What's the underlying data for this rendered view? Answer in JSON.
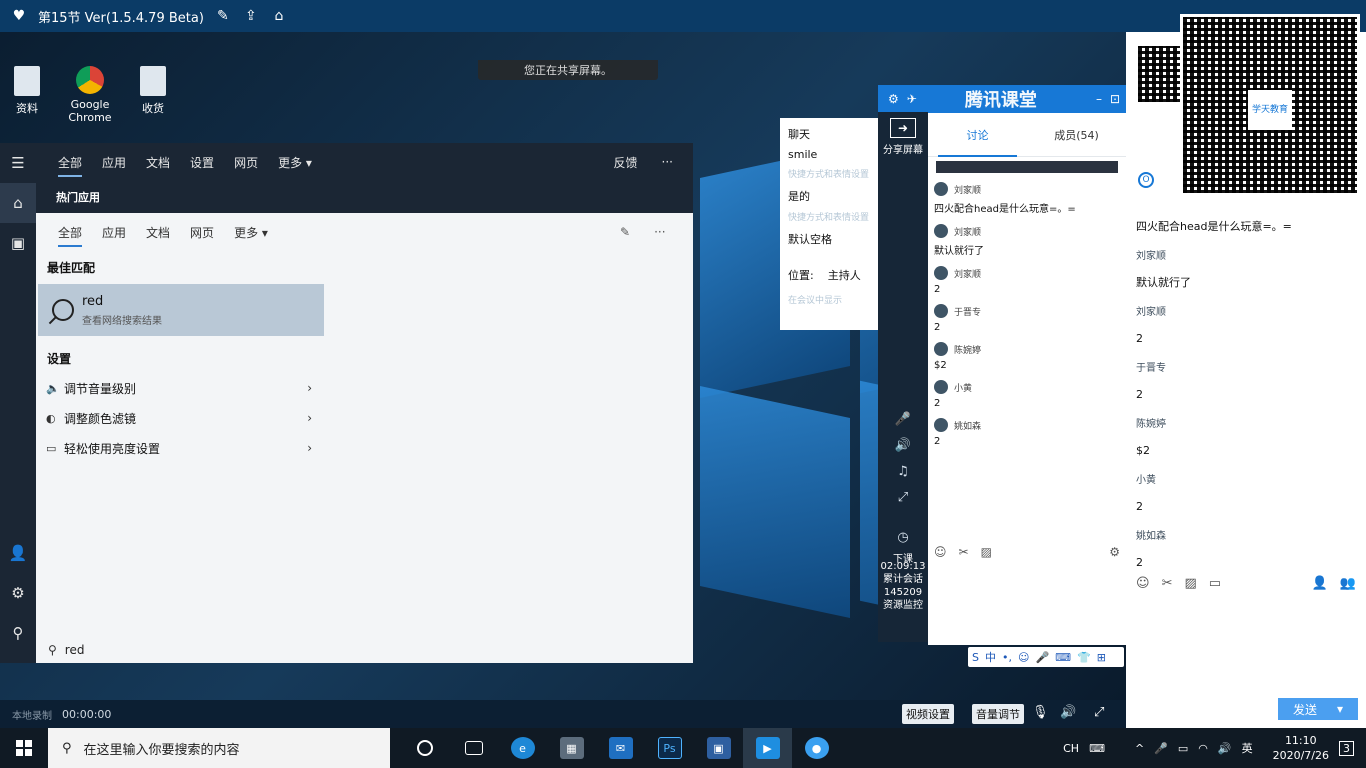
{
  "app_titlebar": {
    "title": "第15节 Ver(1.5.4.79 Beta)"
  },
  "desktop": {
    "share_banner": "您正在共享屏幕。",
    "icons": [
      {
        "label": "资料",
        "icon": "folder-icon"
      },
      {
        "label": "Google Chrome",
        "icon": "chrome-icon"
      },
      {
        "label": "收货",
        "icon": "folder-icon"
      }
    ]
  },
  "search_panel": {
    "tabs_dark": [
      "全部",
      "应用",
      "文档",
      "设置",
      "网页",
      "更多 ▾"
    ],
    "feedback_label": "反馈",
    "more_label": "···",
    "dark_hint": "热门应用",
    "tabs_light": [
      "全部",
      "应用",
      "文档",
      "网页",
      "更多 ▾"
    ],
    "best_match_heading": "最佳匹配",
    "best_match": {
      "title": "red",
      "subtitle": "查看网络搜索结果"
    },
    "settings_heading": "设置",
    "settings_items": [
      {
        "label": "调节音量级别",
        "icon": "speaker-icon"
      },
      {
        "label": "调整颜色滤镜",
        "icon": "palette-icon"
      },
      {
        "label": "轻松使用亮度设置",
        "icon": "monitor-icon"
      }
    ],
    "query": "red"
  },
  "popup": {
    "lines": [
      "聊天",
      "smile",
      "是的",
      "默认空格"
    ],
    "faint_line": "快捷方式和表情设置",
    "position_label": "位置:",
    "position_value": "主持人",
    "footer": "在会议中显示"
  },
  "meeting_toolbar": {
    "share_label": "分享屏幕",
    "timer": "02:09:13",
    "stats": [
      "累计会话",
      "145209",
      "资源监控"
    ],
    "wait_label": "下课"
  },
  "meeting_window": {
    "brand": "腾讯课堂",
    "tabs": [
      "讨论",
      "成员(54)"
    ],
    "messages": [
      {
        "name": "刘家顺",
        "text": "四火配合head是什么玩意=。="
      },
      {
        "name": "刘家顺",
        "text": "默认就行了"
      },
      {
        "name": "刘家顺",
        "text": "2"
      },
      {
        "name": "于晋专",
        "text": "2"
      },
      {
        "name": "陈婉婷",
        "text": "$2"
      },
      {
        "name": "小黄",
        "text": "2"
      },
      {
        "name": "姚如森",
        "text": "2"
      }
    ],
    "send_label": "发送"
  },
  "right_chat": {
    "messages": [
      {
        "name": "",
        "text": "四火配合head是什么玩意=。="
      },
      {
        "name": "刘家顺",
        "text": "默认就行了"
      },
      {
        "name": "刘家顺",
        "text": "2"
      },
      {
        "name": "于晋专",
        "text": "2"
      },
      {
        "name": "陈婉婷",
        "text": "$2"
      },
      {
        "name": "小黄",
        "text": "2"
      },
      {
        "name": "姚如森",
        "text": "2"
      }
    ],
    "qr_logo": "学天教育",
    "send_label": "发送"
  },
  "meeting_bar": {
    "record_label": "本地录制",
    "time": "00:00:00",
    "video_settings": "视频设置",
    "volume_label": "音量调节"
  },
  "taskbar": {
    "search_placeholder": "在这里输入你要搜索的内容",
    "ime": "CH",
    "time": "11:10",
    "date": "2020/7/26",
    "notification_count": "3"
  },
  "colors": {
    "accent": "#1778d6",
    "taskbar": "#101a24",
    "search_dark": "#1b2634"
  }
}
